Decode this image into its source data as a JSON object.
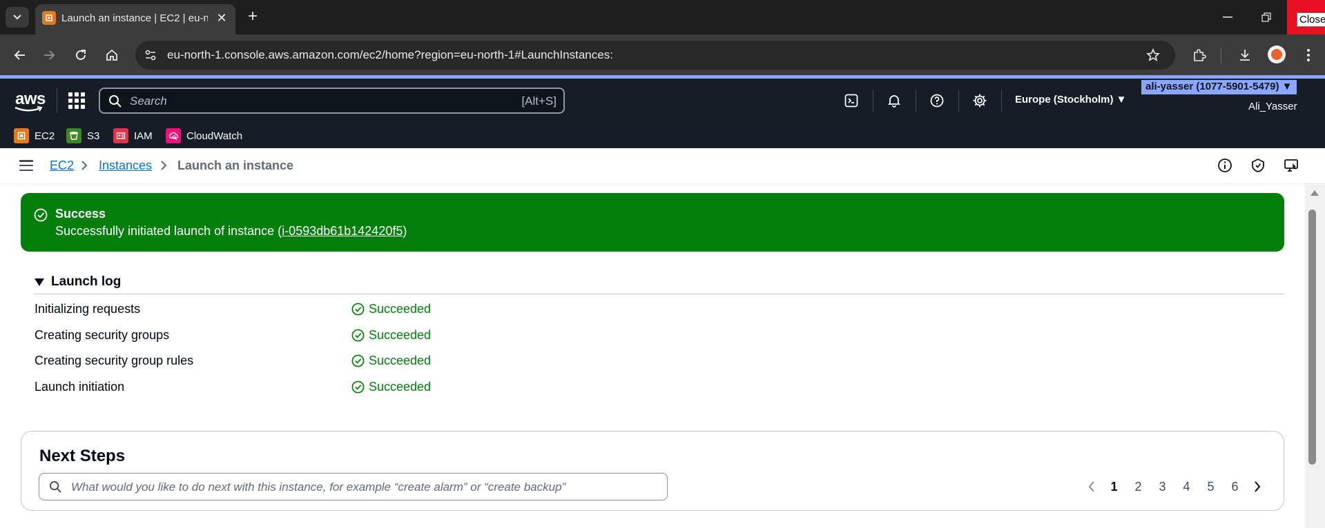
{
  "browser": {
    "tab_title": "Launch an instance | EC2 | eu-north-1",
    "url": "eu-north-1.console.aws.amazon.com/ec2/home?region=eu-north-1#LaunchInstances:",
    "close_tooltip": "Close",
    "icons": [
      "tab-list-icon",
      "new-tab-icon",
      "back-icon",
      "forward-icon",
      "reload-icon",
      "home-icon",
      "site-info-icon",
      "bookmark-star-icon",
      "extensions-icon",
      "download-icon",
      "profile-avatar",
      "menu-icon"
    ]
  },
  "aws_header": {
    "logo": "aws",
    "search_placeholder": "Search",
    "search_shortcut": "[Alt+S]",
    "region": "Europe (Stockholm) ▼",
    "account": "ali-yasser (1077-5901-5479) ▼",
    "user": "Ali_Yasser",
    "favorites": [
      {
        "label": "EC2",
        "color": "#e07a1f"
      },
      {
        "label": "S3",
        "color": "#3f8624"
      },
      {
        "label": "IAM",
        "color": "#dd344c"
      },
      {
        "label": "CloudWatch",
        "color": "#e7157b"
      }
    ]
  },
  "breadcrumb": {
    "items": [
      "EC2",
      "Instances"
    ],
    "current": "Launch an instance"
  },
  "flash": {
    "title": "Success",
    "message_prefix": "Successfully initiated launch of instance (",
    "instance_id": "i-0593db61b142420f5",
    "message_suffix": ")",
    "color": "#037f0c"
  },
  "launch_log": {
    "title": "Launch log",
    "rows": [
      {
        "step": "Initializing requests",
        "status": "Succeeded"
      },
      {
        "step": "Creating security groups",
        "status": "Succeeded"
      },
      {
        "step": "Creating security group rules",
        "status": "Succeeded"
      },
      {
        "step": "Launch initiation",
        "status": "Succeeded"
      }
    ]
  },
  "next_steps": {
    "title": "Next Steps",
    "search_placeholder": "What would you like to do next with this instance, for example “create alarm” or “create backup”",
    "pages": [
      "1",
      "2",
      "3",
      "4",
      "5",
      "6"
    ],
    "current_page": "1"
  }
}
